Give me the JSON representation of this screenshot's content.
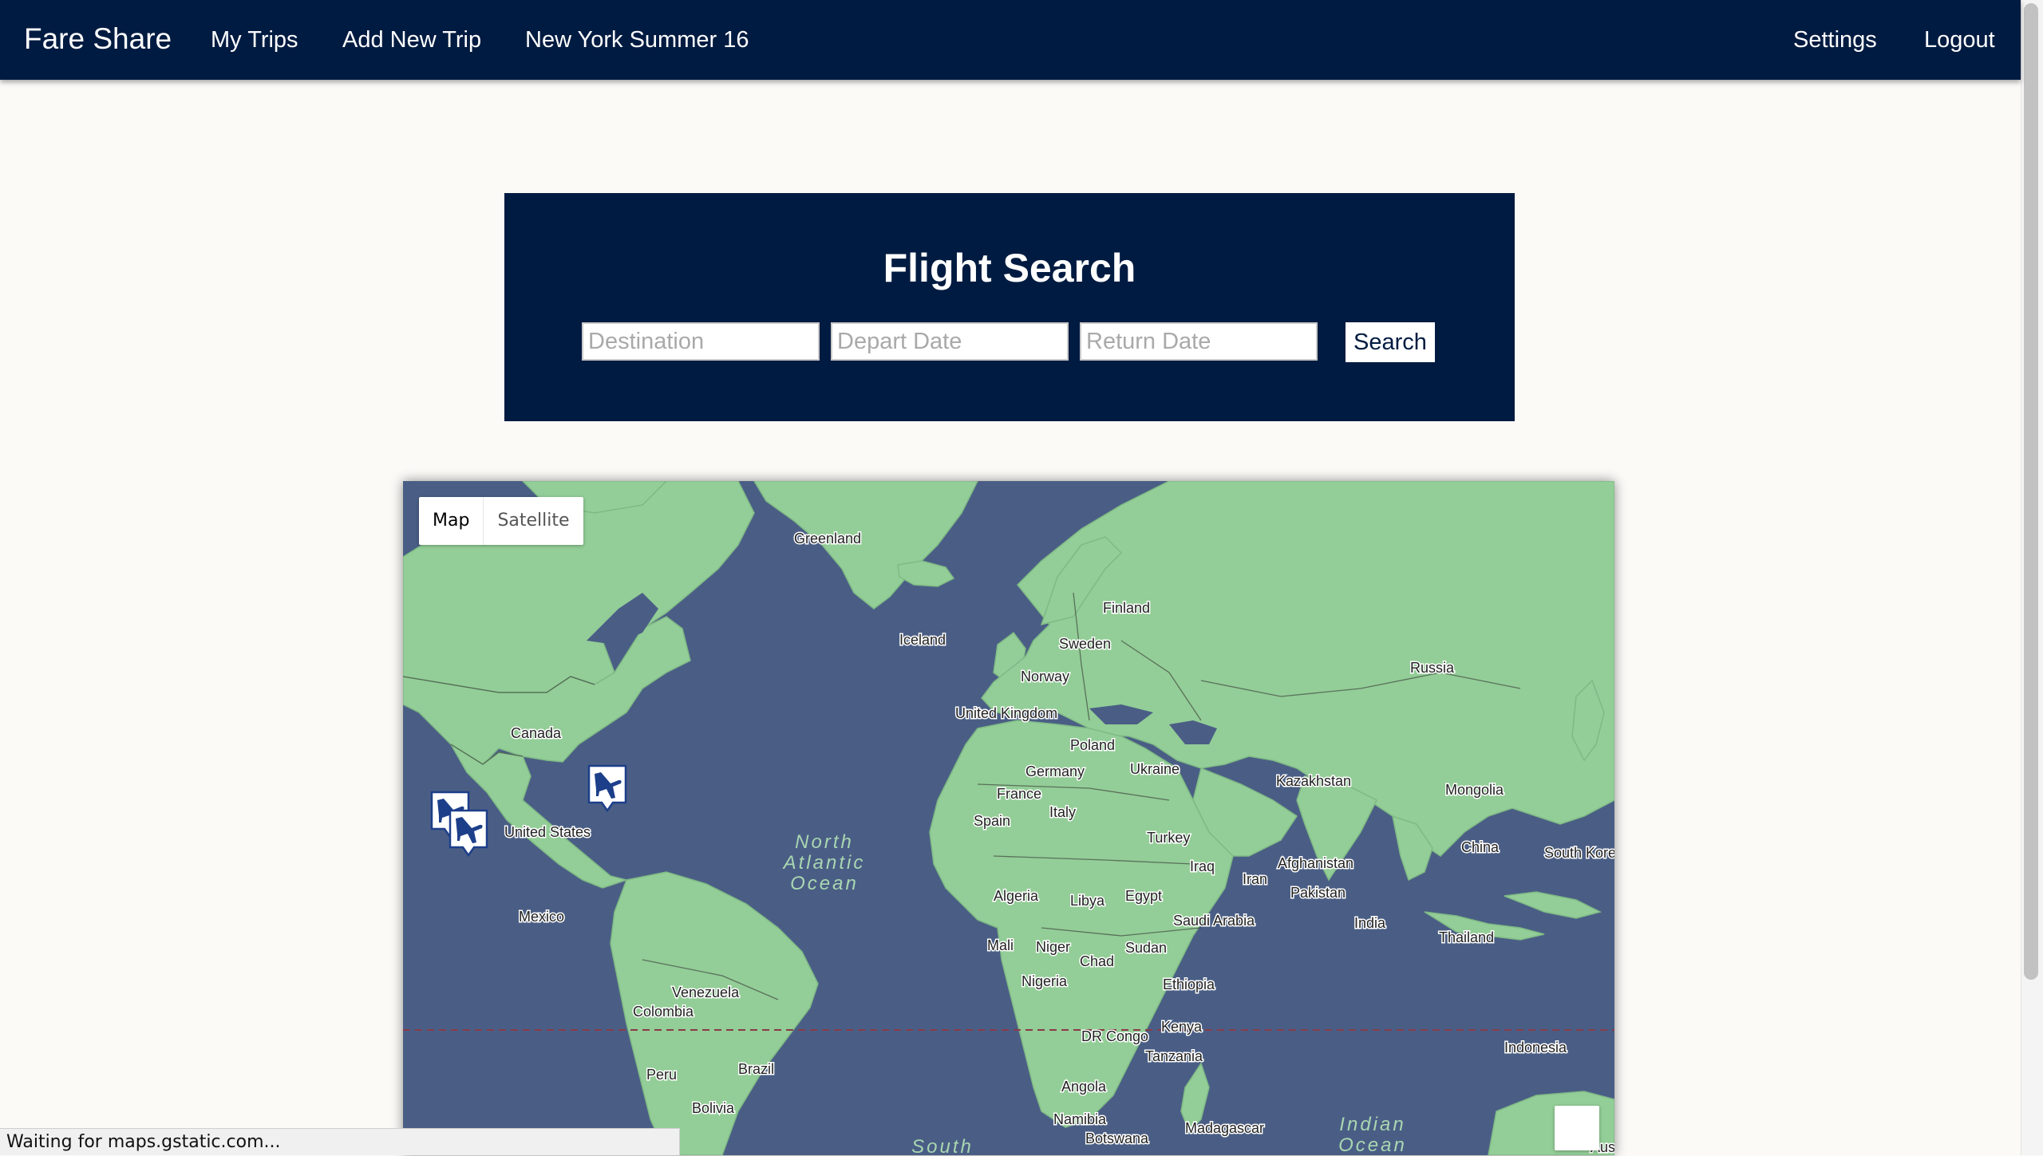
{
  "nav": {
    "brand": "Fare Share",
    "links": [
      "My Trips",
      "Add New Trip",
      "New York Summer 16"
    ],
    "right_links": [
      "Settings",
      "Logout"
    ]
  },
  "search": {
    "title": "Flight Search",
    "destination_placeholder": "Destination",
    "depart_placeholder": "Depart Date",
    "return_placeholder": "Return Date",
    "button_label": "Search"
  },
  "map": {
    "type_options": [
      "Map",
      "Satellite"
    ],
    "active_type": "Map",
    "colors": {
      "water": "#4a5e85",
      "land": "#93cd97",
      "equator": "#8a3a4a",
      "marker": "#1d3f8a"
    },
    "labels": {
      "greenland": "Greenland",
      "iceland": "Iceland",
      "finland": "Finland",
      "sweden": "Sweden",
      "norway": "Norway",
      "russia": "Russia",
      "canada": "Canada",
      "united_kingdom": "United Kingdom",
      "poland": "Poland",
      "germany": "Germany",
      "ukraine": "Ukraine",
      "kazakhstan": "Kazakhstan",
      "mongolia": "Mongolia",
      "france": "France",
      "spain": "Spain",
      "italy": "Italy",
      "turkey": "Turkey",
      "united_states": "United States",
      "china": "China",
      "south_korea": "South Kore",
      "iraq": "Iraq",
      "iran": "Iran",
      "afghanistan": "Afghanistan",
      "pakistan": "Pakistan",
      "algeria": "Algeria",
      "libya": "Libya",
      "egypt": "Egypt",
      "saudi_arabia": "Saudi Arabia",
      "mexico": "Mexico",
      "india": "India",
      "thailand": "Thailand",
      "mali": "Mali",
      "niger": "Niger",
      "chad": "Chad",
      "sudan": "Sudan",
      "nigeria": "Nigeria",
      "ethiopia": "Ethiopia",
      "venezuela": "Venezuela",
      "colombia": "Colombia",
      "kenya": "Kenya",
      "dr_congo": "DR Congo",
      "tanzania": "Tanzania",
      "indonesia": "Indonesia",
      "peru": "Peru",
      "brazil": "Brazil",
      "angola": "Angola",
      "bolivia": "Bolivia",
      "namibia": "Namibia",
      "madagascar": "Madagascar",
      "botswana": "Botswana",
      "australia_partial": "Aus"
    },
    "oceans": {
      "north_atlantic": [
        "North",
        "Atlantic",
        "Ocean"
      ],
      "indian": [
        "Indian",
        "Ocean"
      ],
      "south": "South"
    },
    "markers": [
      "airplane-marker",
      "airplane-marker",
      "airplane-marker"
    ]
  },
  "status_bar": "Waiting for maps.gstatic.com..."
}
